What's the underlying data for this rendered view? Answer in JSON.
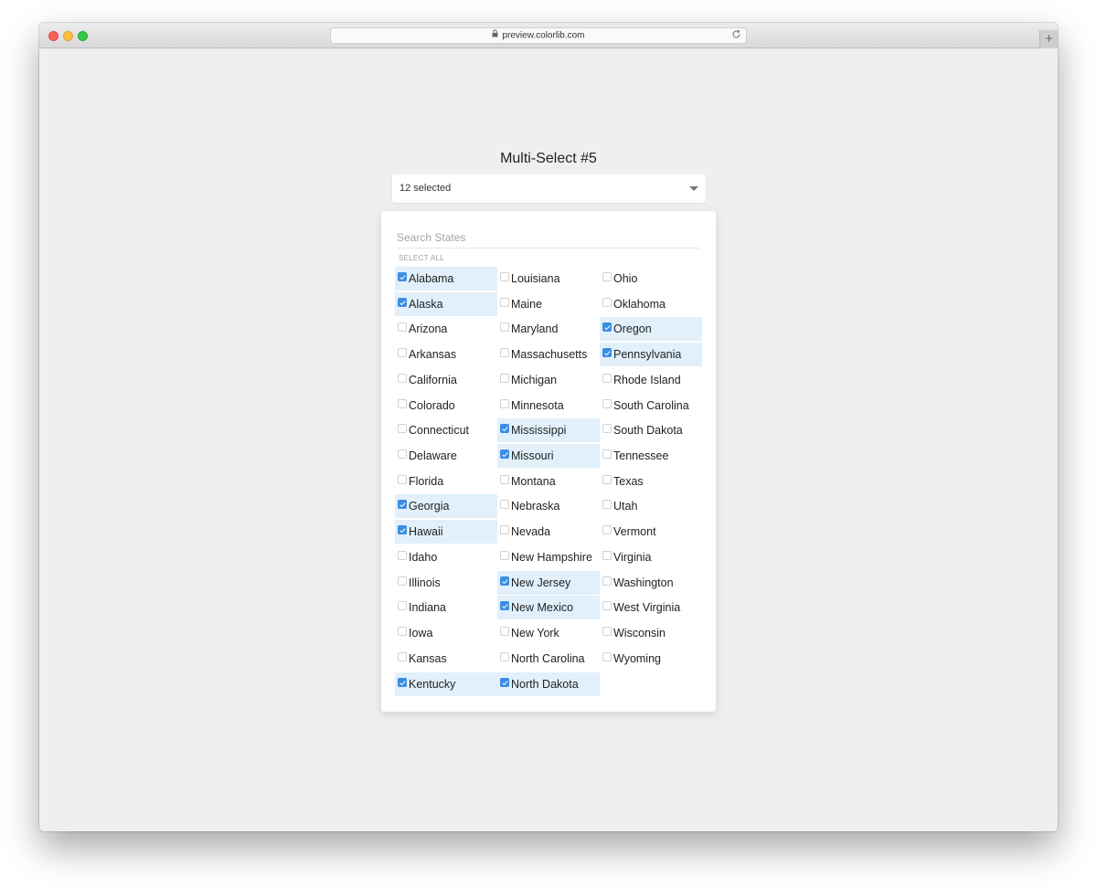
{
  "browser": {
    "url": "preview.colorlib.com"
  },
  "page": {
    "title": "Multi-Select #5"
  },
  "select": {
    "value": "12 selected"
  },
  "dropdown": {
    "search_placeholder": "Search States",
    "select_all_label": "SELECT ALL",
    "columns": [
      [
        {
          "label": "Alabama",
          "checked": true
        },
        {
          "label": "Alaska",
          "checked": true
        },
        {
          "label": "Arizona",
          "checked": false
        },
        {
          "label": "Arkansas",
          "checked": false
        },
        {
          "label": "California",
          "checked": false
        },
        {
          "label": "Colorado",
          "checked": false
        },
        {
          "label": "Connecticut",
          "checked": false
        },
        {
          "label": "Delaware",
          "checked": false
        },
        {
          "label": "Florida",
          "checked": false
        },
        {
          "label": "Georgia",
          "checked": true
        },
        {
          "label": "Hawaii",
          "checked": true
        },
        {
          "label": "Idaho",
          "checked": false
        },
        {
          "label": "Illinois",
          "checked": false
        },
        {
          "label": "Indiana",
          "checked": false
        },
        {
          "label": "Iowa",
          "checked": false
        },
        {
          "label": "Kansas",
          "checked": false
        },
        {
          "label": "Kentucky",
          "checked": true
        }
      ],
      [
        {
          "label": "Louisiana",
          "checked": false
        },
        {
          "label": "Maine",
          "checked": false
        },
        {
          "label": "Maryland",
          "checked": false
        },
        {
          "label": "Massachusetts",
          "checked": false
        },
        {
          "label": "Michigan",
          "checked": false
        },
        {
          "label": "Minnesota",
          "checked": false
        },
        {
          "label": "Mississippi",
          "checked": true
        },
        {
          "label": "Missouri",
          "checked": true
        },
        {
          "label": "Montana",
          "checked": false
        },
        {
          "label": "Nebraska",
          "checked": false
        },
        {
          "label": "Nevada",
          "checked": false
        },
        {
          "label": "New Hampshire",
          "checked": false
        },
        {
          "label": "New Jersey",
          "checked": true
        },
        {
          "label": "New Mexico",
          "checked": true
        },
        {
          "label": "New York",
          "checked": false
        },
        {
          "label": "North Carolina",
          "checked": false
        },
        {
          "label": "North Dakota",
          "checked": true
        }
      ],
      [
        {
          "label": "Ohio",
          "checked": false
        },
        {
          "label": "Oklahoma",
          "checked": false
        },
        {
          "label": "Oregon",
          "checked": true
        },
        {
          "label": "Pennsylvania",
          "checked": true
        },
        {
          "label": "Rhode Island",
          "checked": false
        },
        {
          "label": "South Carolina",
          "checked": false
        },
        {
          "label": "South Dakota",
          "checked": false
        },
        {
          "label": "Tennessee",
          "checked": false
        },
        {
          "label": "Texas",
          "checked": false
        },
        {
          "label": "Utah",
          "checked": false
        },
        {
          "label": "Vermont",
          "checked": false
        },
        {
          "label": "Virginia",
          "checked": false
        },
        {
          "label": "Washington",
          "checked": false
        },
        {
          "label": "West Virginia",
          "checked": false
        },
        {
          "label": "Wisconsin",
          "checked": false
        },
        {
          "label": "Wyoming",
          "checked": false
        }
      ]
    ]
  },
  "colors": {
    "accent": "#3b8ee2",
    "selected_bg": "#e1f0fb",
    "page_bg": "#efefef"
  },
  "icons": {
    "lock": "lock-icon",
    "reload": "reload-icon",
    "caret": "chevron-down-icon",
    "new_tab": "plus-icon"
  }
}
